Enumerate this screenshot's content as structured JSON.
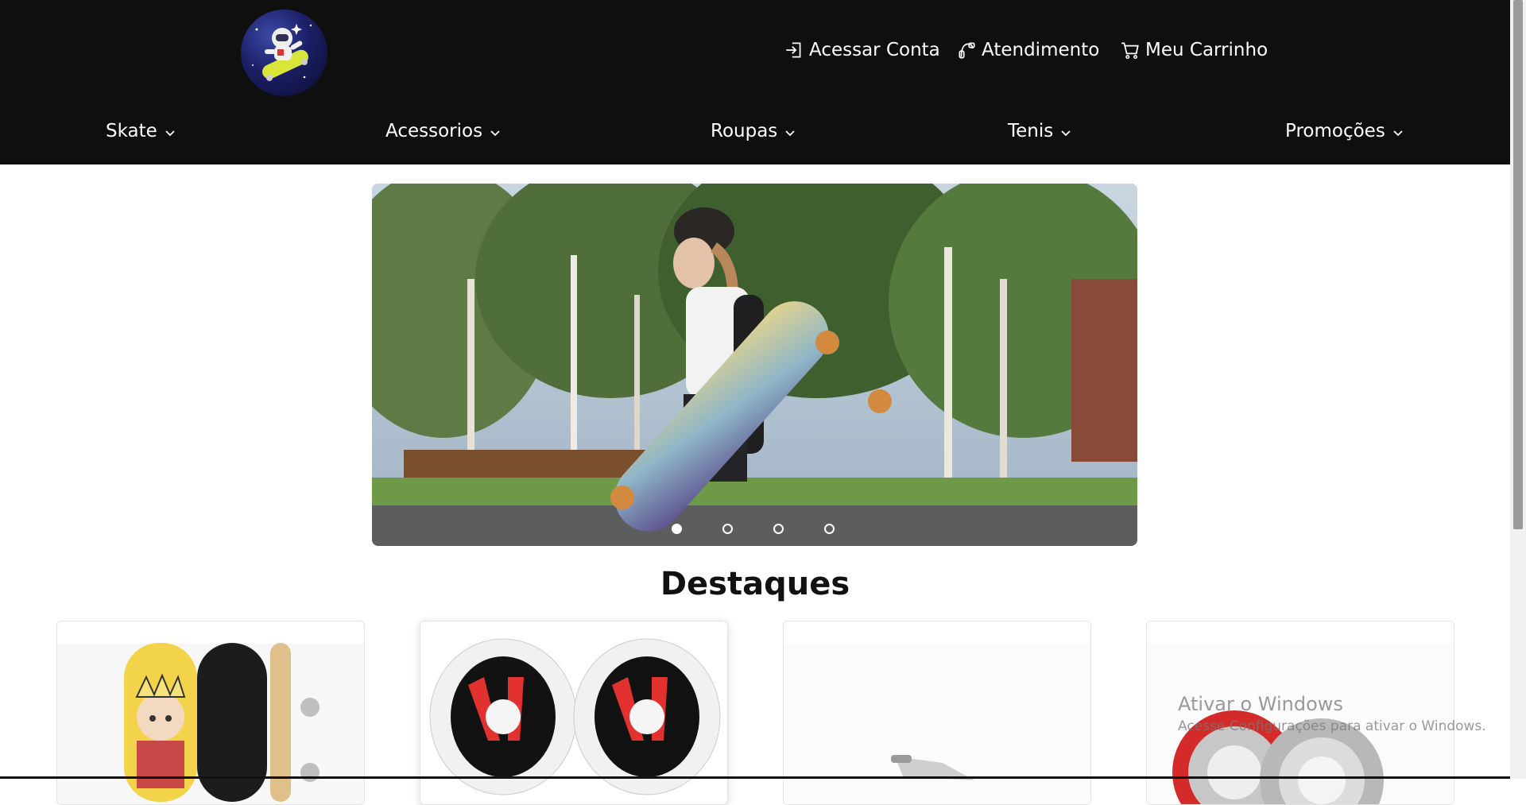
{
  "header": {
    "logo_icon": "astronaut-skateboard-logo",
    "account_link": {
      "label": "Acessar Conta",
      "icon": "login-icon"
    },
    "support_link": {
      "label": "Atendimento",
      "icon": "support-icon"
    },
    "cart_link": {
      "label": "Meu Carrinho",
      "icon": "cart-icon"
    }
  },
  "nav": {
    "items": [
      {
        "label": "Skate"
      },
      {
        "label": "Acessorios"
      },
      {
        "label": "Roupas"
      },
      {
        "label": "Tenis"
      },
      {
        "label": "Promoções"
      }
    ]
  },
  "carousel": {
    "image": "woman-holding-longboard-photo",
    "slide_count": 4,
    "active_slide": 1
  },
  "highlights": {
    "title": "Destaques",
    "cards": [
      {
        "image": "skateboard-deck-product"
      },
      {
        "image": "skate-wheels-product"
      },
      {
        "image": "skate-truck-product"
      },
      {
        "image": "skate-bearings-product"
      }
    ]
  },
  "watermark": {
    "title": "Ativar o Windows",
    "subtitle": "Acesse Configurações para ativar o Windows."
  },
  "colors": {
    "header_bg": "#0f0f0f",
    "header_text": "#ffffff",
    "page_bg": "#ffffff"
  }
}
